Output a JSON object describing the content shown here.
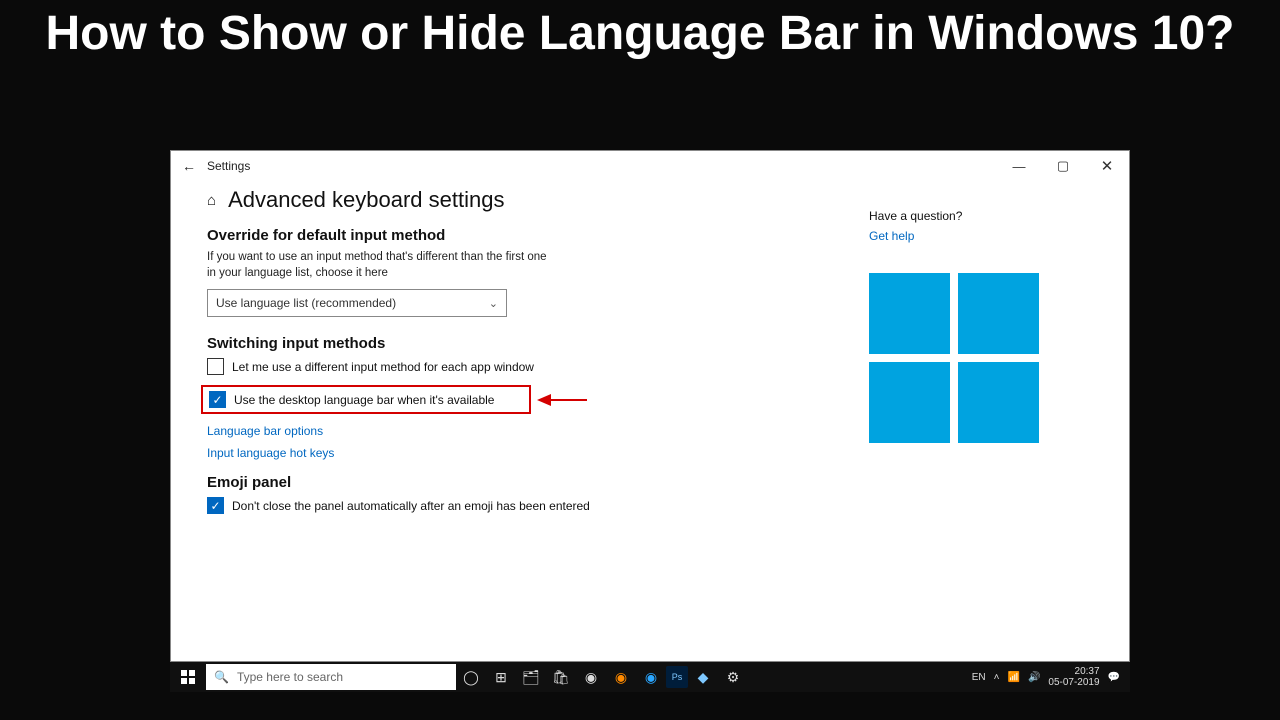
{
  "headline": "How to Show or Hide Language Bar in Windows 10?",
  "window": {
    "app_name": "Settings",
    "page_title": "Advanced keyboard settings"
  },
  "override": {
    "heading": "Override for default input method",
    "desc": "If you want to use an input method that's different than the first one in your language list, choose it here",
    "select_value": "Use language list (recommended)"
  },
  "switching": {
    "heading": "Switching input methods",
    "cb1_label": "Let me use a different input method for each app window",
    "cb2_label": "Use the desktop language bar when it's available",
    "link1": "Language bar options",
    "link2": "Input language hot keys"
  },
  "emoji": {
    "heading": "Emoji panel",
    "cb_label": "Don't close the panel automatically after an emoji has been entered"
  },
  "help": {
    "q": "Have a question?",
    "link": "Get help"
  },
  "taskbar": {
    "search_placeholder": "Type here to search",
    "lang": "EN",
    "time": "20:37",
    "date": "05-07-2019"
  }
}
